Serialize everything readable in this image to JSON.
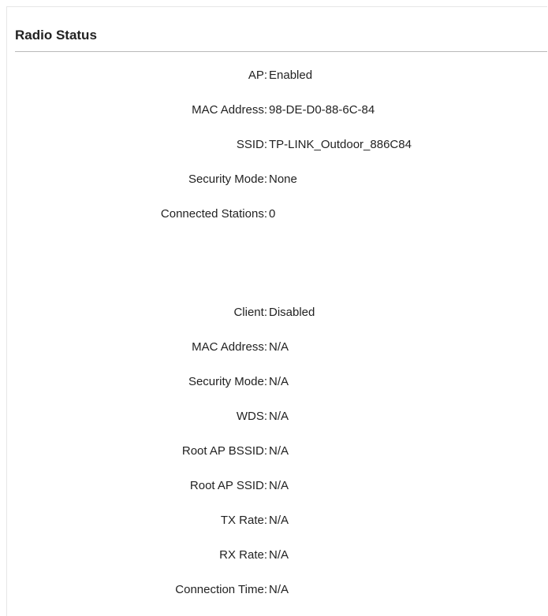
{
  "panel": {
    "title": "Radio Status"
  },
  "ap_section": [
    {
      "label": "AP:",
      "value": "Enabled"
    },
    {
      "label": "MAC Address:",
      "value": "98-DE-D0-88-6C-84"
    },
    {
      "label": "SSID:",
      "value": "TP-LINK_Outdoor_886C84"
    },
    {
      "label": "Security Mode:",
      "value": "None"
    },
    {
      "label": "Connected Stations:",
      "value": "0"
    }
  ],
  "client_section": [
    {
      "label": "Client:",
      "value": "Disabled"
    },
    {
      "label": "MAC Address:",
      "value": "N/A"
    },
    {
      "label": "Security Mode:",
      "value": "N/A"
    },
    {
      "label": "WDS:",
      "value": "N/A"
    },
    {
      "label": "Root AP BSSID:",
      "value": "N/A"
    },
    {
      "label": "Root AP SSID:",
      "value": "N/A"
    },
    {
      "label": "TX Rate:",
      "value": "N/A"
    },
    {
      "label": "RX Rate:",
      "value": "N/A"
    },
    {
      "label": "Connection Time:",
      "value": "N/A"
    }
  ]
}
